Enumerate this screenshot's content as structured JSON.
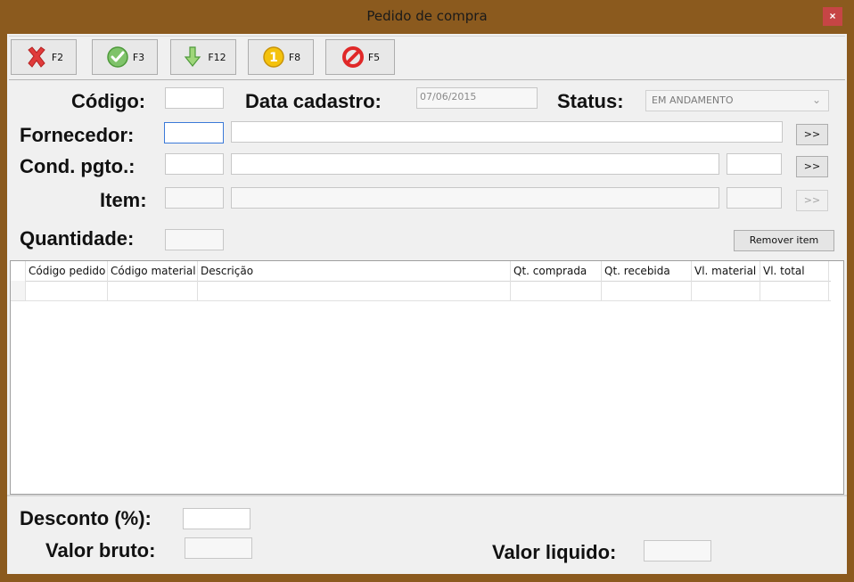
{
  "window": {
    "title": "Pedido de compra",
    "close_label": "×"
  },
  "toolbar": {
    "buttons": [
      {
        "key": "F2",
        "icon": "cancel-x-icon"
      },
      {
        "key": "F3",
        "icon": "confirm-check-icon"
      },
      {
        "key": "F12",
        "icon": "down-arrow-icon"
      },
      {
        "key": "F8",
        "icon": "info-coin-icon"
      },
      {
        "key": "F5",
        "icon": "forbidden-icon"
      }
    ]
  },
  "form": {
    "codigo_label": "Código:",
    "codigo_value": "",
    "data_cadastro_label": "Data cadastro:",
    "data_cadastro_value": "07/06/2015",
    "status_label": "Status:",
    "status_value": "EM ANDAMENTO",
    "fornecedor_label": "Fornecedor:",
    "cond_pgto_label": "Cond. pgto.:",
    "item_label": "Item:",
    "quantidade_label": "Quantidade:",
    "lookup_label": ">>",
    "remover_item_label": "Remover item"
  },
  "grid": {
    "columns": [
      "Código pedido",
      "Código material",
      "Descrição",
      "Qt. comprada",
      "Qt. recebida",
      "Vl. material",
      "Vl. total"
    ],
    "rows": [
      [
        "",
        "",
        "",
        "",
        "",
        "",
        ""
      ]
    ]
  },
  "footer": {
    "desconto_label": "Desconto (%):",
    "valor_bruto_label": "Valor bruto:",
    "valor_liquido_label": "Valor liquido:"
  },
  "colors": {
    "frame": "#8b5a1e",
    "background": "#f0f0f0",
    "close": "#c64545",
    "focus_border": "#3b7ad8"
  }
}
